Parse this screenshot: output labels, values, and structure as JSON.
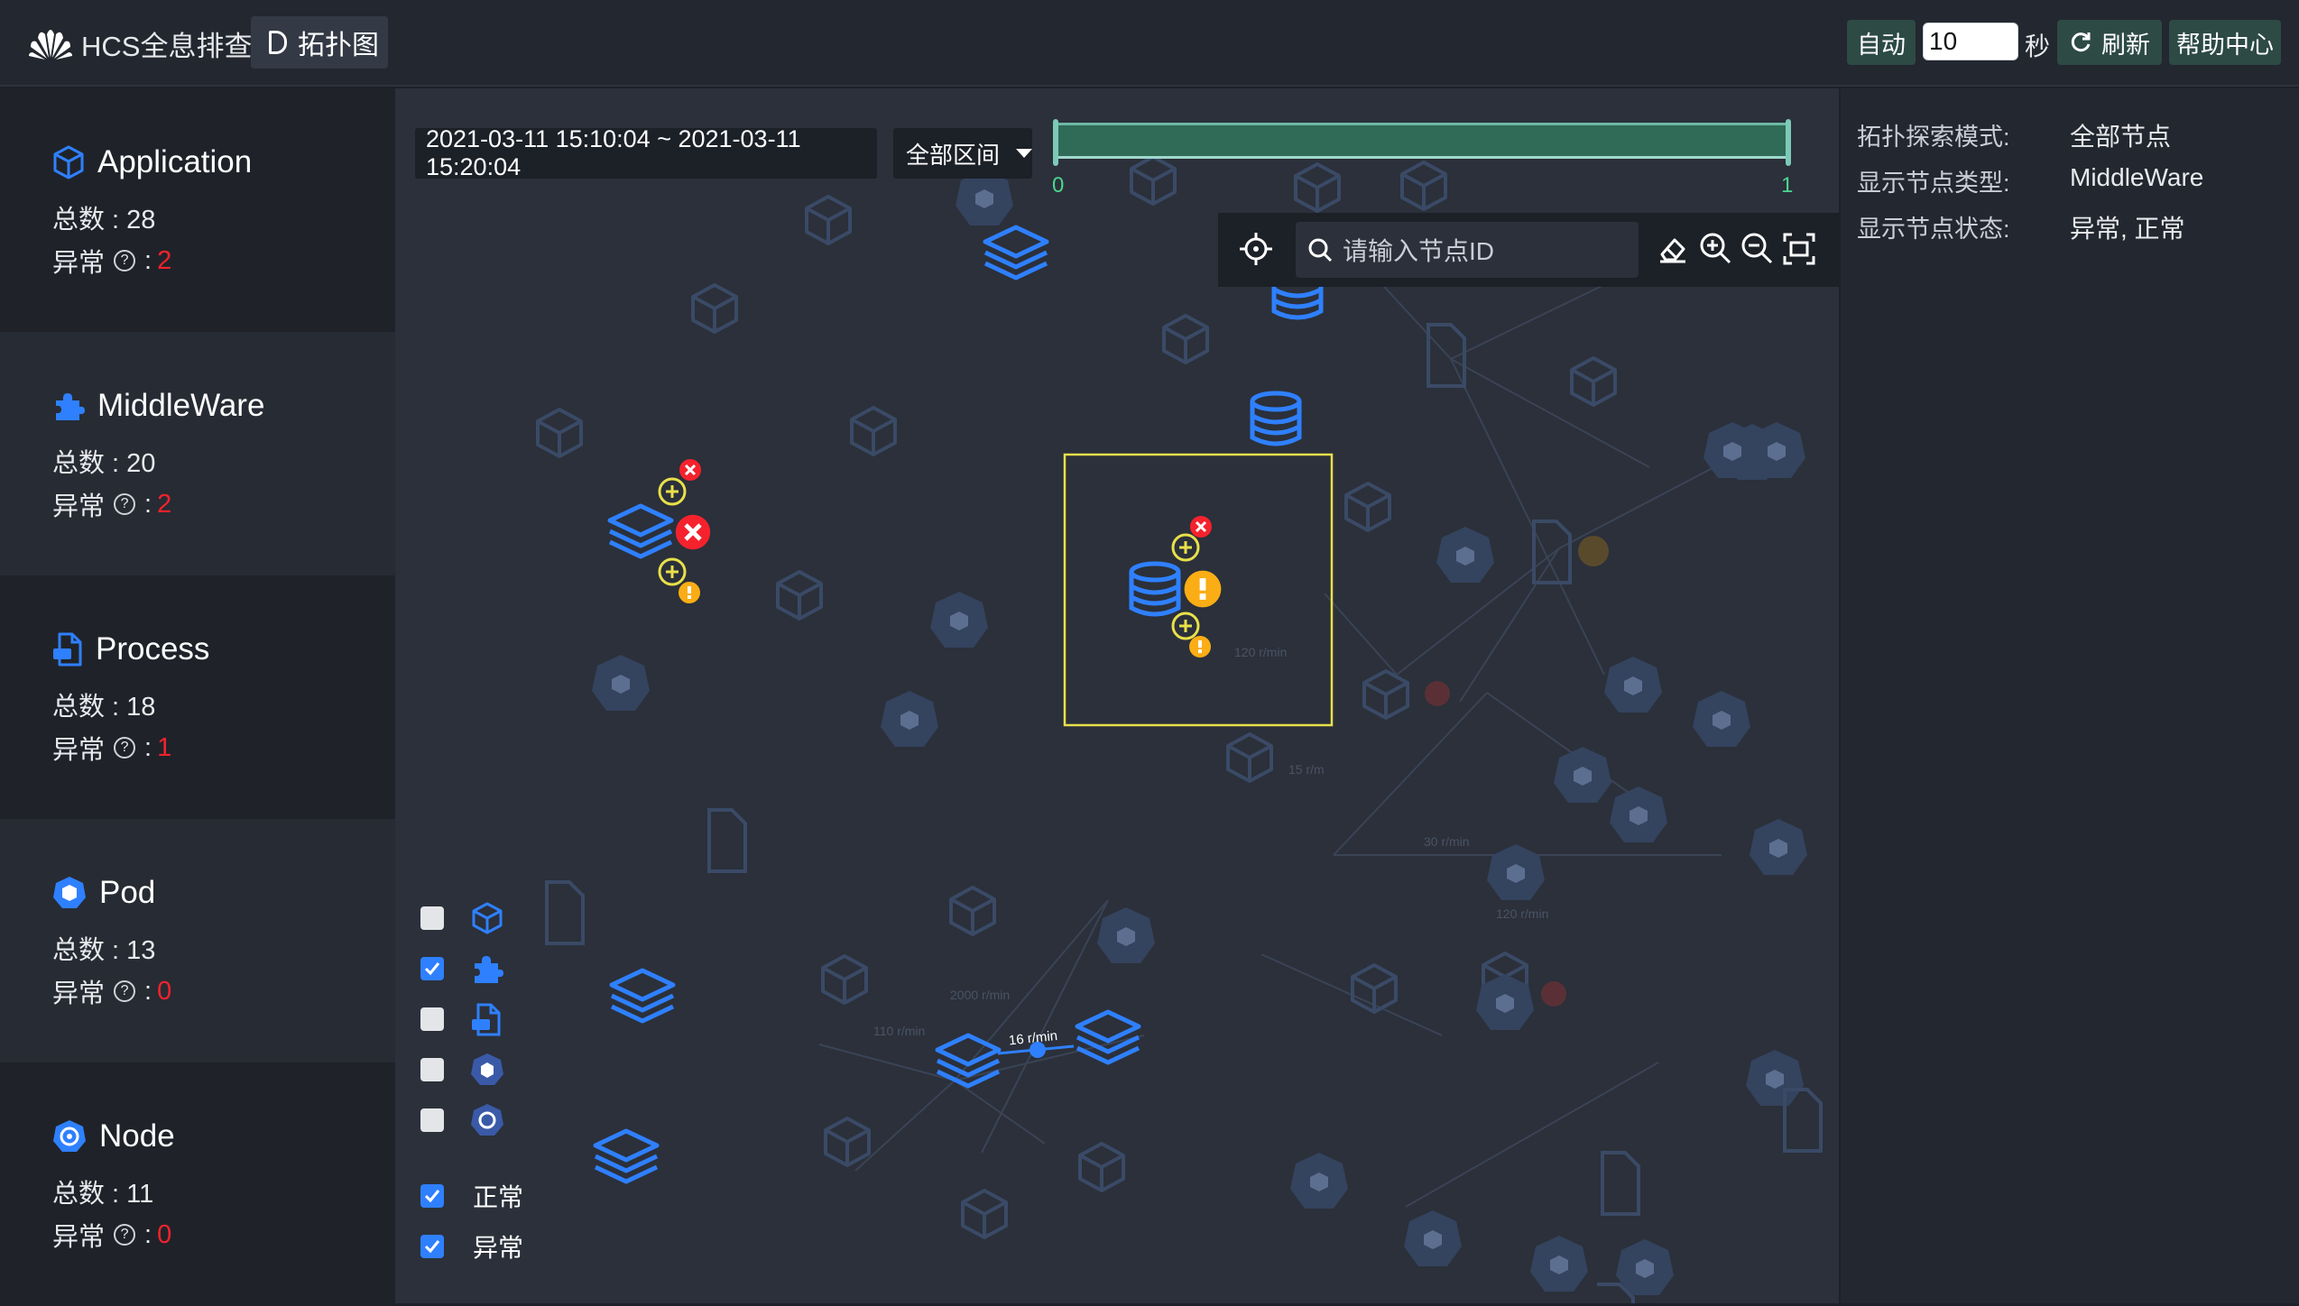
{
  "header": {
    "title": "HCS全息排查",
    "tab_label": "拓扑图",
    "auto_label": "自动",
    "interval_value": "10",
    "interval_unit": "秒",
    "refresh_label": "刷新",
    "help_label": "帮助中心"
  },
  "sidebar": {
    "cards": [
      {
        "title": "Application",
        "total_label": "总数 : 28",
        "abnormal_label": "异常",
        "abnormal_count": "2"
      },
      {
        "title": "MiddleWare",
        "total_label": "总数 : 20",
        "abnormal_label": "异常",
        "abnormal_count": "2"
      },
      {
        "title": "Process",
        "total_label": "总数 : 18",
        "abnormal_label": "异常",
        "abnormal_count": "1"
      },
      {
        "title": "Pod",
        "total_label": "总数 : 13",
        "abnormal_label": "异常",
        "abnormal_count": "0"
      },
      {
        "title": "Node",
        "total_label": "总数 : 11",
        "abnormal_label": "异常",
        "abnormal_count": "0"
      }
    ]
  },
  "canvas": {
    "time_range": "2021-03-11 15:10:04 ~ 2021-03-11 15:20:04",
    "range_select": "全部区间",
    "slider_min": "0",
    "slider_max": "1",
    "search_placeholder": "请输入节点ID",
    "edge_label": "16 r/min",
    "legend": {
      "normal_label": "正常",
      "abnormal_label": "异常"
    }
  },
  "right_panel": {
    "rows": [
      {
        "label": "拓扑探索模式:",
        "value": "全部节点"
      },
      {
        "label": "显示节点类型:",
        "value": "MiddleWare"
      },
      {
        "label": "显示节点状态:",
        "value": "异常, 正常"
      }
    ]
  },
  "colors": {
    "accent_blue": "#2f80ff",
    "error_red": "#f5222d",
    "warning_orange": "#faad14",
    "selection_yellow": "#e8e04a"
  }
}
